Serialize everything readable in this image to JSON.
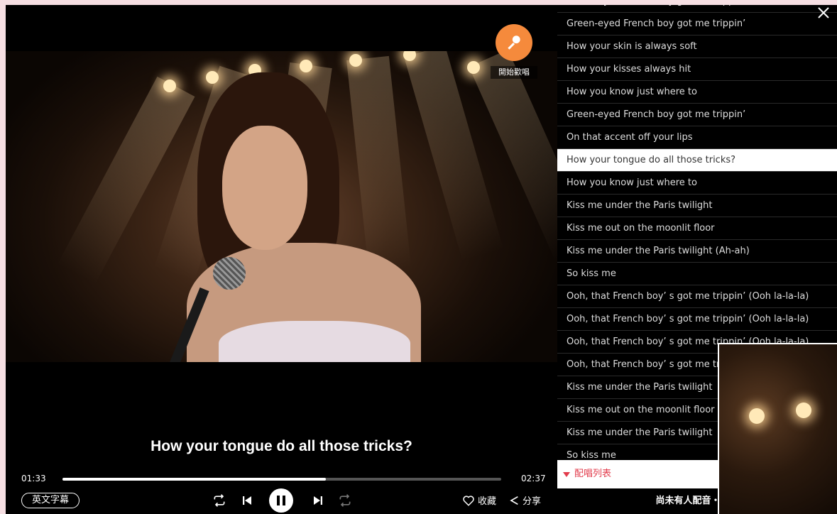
{
  "player": {
    "sing_label": "開始歡唱",
    "subtitle": "How your tongue do all those tricks?",
    "current_time": "01:33",
    "total_time": "02:37",
    "progress_percent": 60,
    "subtitle_toggle_label": "英文字幕",
    "favorite_label": "收藏",
    "share_label": "分享"
  },
  "lyrics": {
    "active_index": 7,
    "lines": [
      "Green-eyed French boy got me trippin’",
      "Green-eyed French boy got me trippin’",
      "How your skin is always soft",
      "How your kisses always hit",
      "How you know just where to",
      "Green-eyed French boy got me trippin’",
      "On that accent off your lips",
      "How your tongue do all those tricks?",
      "How you know just where to",
      "Kiss me under the Paris twilight",
      "Kiss me out on the moonlit floor",
      "Kiss me under the Paris twilight (Ah-ah)",
      "So kiss me",
      "Ooh, that French boy’ s got me trippin’ (Ooh la-la-la)",
      "Ooh, that French boy’ s got me trippin’ (Ooh la-la-la)",
      "Ooh, that French boy’ s got me trippin’ (Ooh la-la-la)",
      "Ooh, that French boy’ s got me trippin’ (Ooh la-la-la)",
      "Kiss me under the Paris twilight",
      "Kiss me out on the moonlit floor",
      "Kiss me under the Paris twilight",
      "So kiss me"
    ]
  },
  "karaoke": {
    "list_label": "配唱列表",
    "empty_note": "尚未有人配音・馬上"
  },
  "colors": {
    "accent_orange": "#f58a3c",
    "karaoke_red": "#e23b4b"
  }
}
